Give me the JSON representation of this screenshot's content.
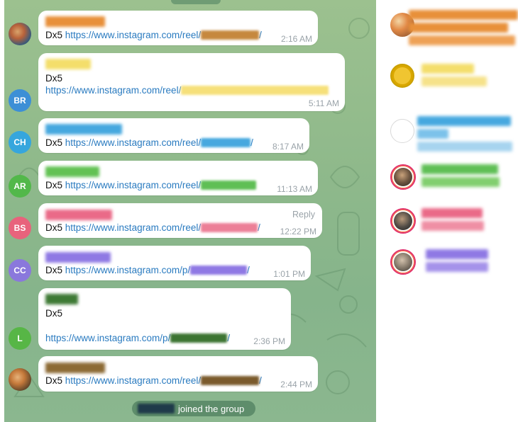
{
  "messages": [
    {
      "avatar": "photo",
      "sender_color": "#e8903a",
      "prefix": "Dx5",
      "url": "https://www.instagram.com/reel/",
      "suffix": "/",
      "redact_color": "#c6883e",
      "time": "2:16 AM"
    },
    {
      "avatar": "BR",
      "avatar_color": "#3d8fd6",
      "sender_color": "#f4de6b",
      "prefix": "Dx5",
      "url": "https://www.instagram.com/reel/",
      "suffix": "",
      "redact_color": "#f6e07a",
      "time": "5:11 AM"
    },
    {
      "avatar": "CH",
      "avatar_color": "#36a6dd",
      "sender_color": "#46a8df",
      "prefix": "Dx5",
      "url": "https://www.instagram.com/reel/",
      "suffix": "/",
      "redact_color": "#46a8df",
      "time": "8:17 AM"
    },
    {
      "avatar": "AR",
      "avatar_color": "#52b84a",
      "sender_color": "#62c253",
      "prefix": "Dx5",
      "url": "https://www.instagram.com/reel/",
      "suffix": "/",
      "redact_color": "#5fbf55",
      "time": "11:13 AM"
    },
    {
      "avatar": "BS",
      "avatar_color": "#e8637c",
      "sender_color": "#ea6a88",
      "prefix": "Dx5",
      "url": "https://www.instagram.com/reel/",
      "suffix": "/",
      "redact_color": "#ec7f97",
      "time": "12:22 PM",
      "reply": "Reply"
    },
    {
      "avatar": "CC",
      "avatar_color": "#8a78dc",
      "sender_color": "#8f79e4",
      "prefix": "Dx5",
      "url": "https://www.instagram.com/p/",
      "suffix": "/",
      "redact_color": "#8f79e4",
      "time": "1:01 PM"
    },
    {
      "avatar": "L",
      "avatar_color": "#57b646",
      "sender_color": "#3e7a35",
      "prefix": "Dx5",
      "url": "https://www.instagram.com/p/",
      "suffix": "/",
      "redact_color": "#3c7432",
      "time": "2:36 PM"
    },
    {
      "avatar": "photo",
      "sender_color": "#8c6a34",
      "prefix": "Dx5",
      "url": "https://www.instagram.com/reel/",
      "suffix": "/",
      "redact_color": "#7a5a2c",
      "time": "2:44 PM"
    }
  ],
  "system": {
    "joined_text": "joined the group",
    "joined_name_color": "#1f3a4a"
  },
  "side_items": [
    {
      "ring": false,
      "line1_color": "#e8903a",
      "line2_color": "#e8903a"
    },
    {
      "ring": false,
      "line1_color": "#f4de6b",
      "line2_color": "#f6e28a"
    },
    {
      "ring": false,
      "line1_color": "#46a8df",
      "line2_color": "#7cc2ea"
    },
    {
      "ring": true,
      "line1_color": "#5fbf55",
      "line2_color": "#82cf6f"
    },
    {
      "ring": true,
      "line1_color": "#ea6a88",
      "line2_color": "#ef8fa4"
    },
    {
      "ring": true,
      "line1_color": "#8f79e4",
      "line2_color": "#a592ea"
    }
  ],
  "icons": {
    "chat_background": "doodle-pattern",
    "avatar_photo": "user-photo-avatar"
  }
}
